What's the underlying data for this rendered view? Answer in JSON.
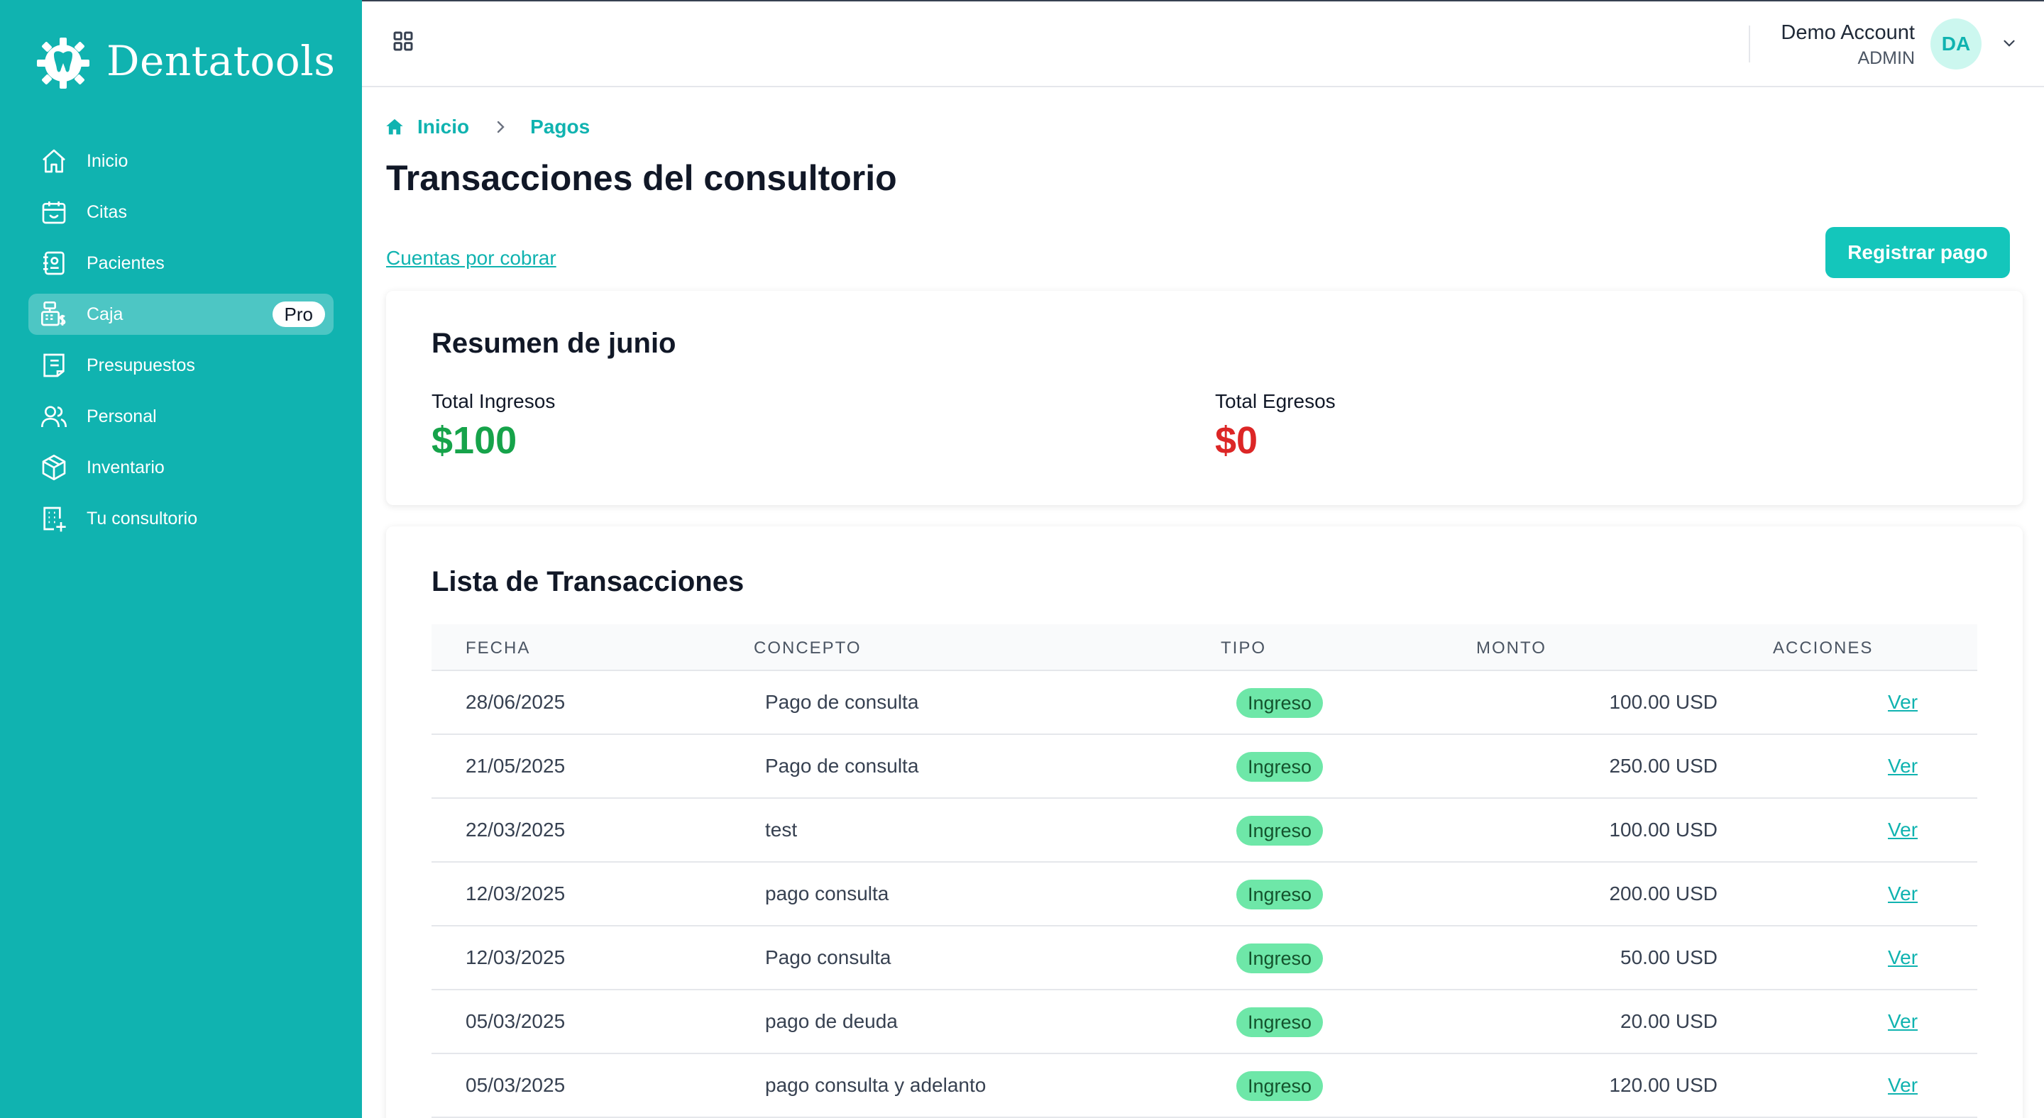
{
  "app": {
    "brand": "Dentatools",
    "brand_color": "#10b3b0"
  },
  "sidebar": {
    "items": [
      {
        "label": "Inicio",
        "icon": "home-icon"
      },
      {
        "label": "Citas",
        "icon": "calendar-icon"
      },
      {
        "label": "Pacientes",
        "icon": "patient-card-icon"
      },
      {
        "label": "Caja",
        "icon": "cash-register-icon",
        "badge": "Pro",
        "active": true
      },
      {
        "label": "Presupuestos",
        "icon": "document-icon"
      },
      {
        "label": "Personal",
        "icon": "users-icon"
      },
      {
        "label": "Inventario",
        "icon": "box-icon"
      },
      {
        "label": "Tu consultorio",
        "icon": "building-add-icon"
      }
    ]
  },
  "header": {
    "user_name": "Demo Account",
    "user_role": "ADMIN",
    "avatar_initials": "DA"
  },
  "breadcrumb": {
    "home": "Inicio",
    "current": "Pagos"
  },
  "page": {
    "title": "Transacciones del consultorio",
    "cuentas_link": "Cuentas por cobrar",
    "register_button": "Registrar pago"
  },
  "summary": {
    "title": "Resumen de junio",
    "income_label": "Total Ingresos",
    "income_value": "$100",
    "expense_label": "Total Egresos",
    "expense_value": "$0"
  },
  "transactions": {
    "title": "Lista de Transacciones",
    "columns": [
      "FECHA",
      "CONCEPTO",
      "TIPO",
      "MONTO",
      "ACCIONES"
    ],
    "rows": [
      {
        "fecha": "28/06/2025",
        "concepto": "Pago de consulta",
        "tipo": "Ingreso",
        "monto": "100.00 USD",
        "accion": "Ver"
      },
      {
        "fecha": "21/05/2025",
        "concepto": "Pago de consulta",
        "tipo": "Ingreso",
        "monto": "250.00 USD",
        "accion": "Ver"
      },
      {
        "fecha": "22/03/2025",
        "concepto": "test",
        "tipo": "Ingreso",
        "monto": "100.00 USD",
        "accion": "Ver"
      },
      {
        "fecha": "12/03/2025",
        "concepto": "pago consulta",
        "tipo": "Ingreso",
        "monto": "200.00 USD",
        "accion": "Ver"
      },
      {
        "fecha": "12/03/2025",
        "concepto": "Pago consulta",
        "tipo": "Ingreso",
        "monto": "50.00 USD",
        "accion": "Ver"
      },
      {
        "fecha": "05/03/2025",
        "concepto": "pago de deuda",
        "tipo": "Ingreso",
        "monto": "20.00 USD",
        "accion": "Ver"
      },
      {
        "fecha": "05/03/2025",
        "concepto": "pago consulta y adelanto",
        "tipo": "Ingreso",
        "monto": "120.00 USD",
        "accion": "Ver"
      }
    ]
  }
}
